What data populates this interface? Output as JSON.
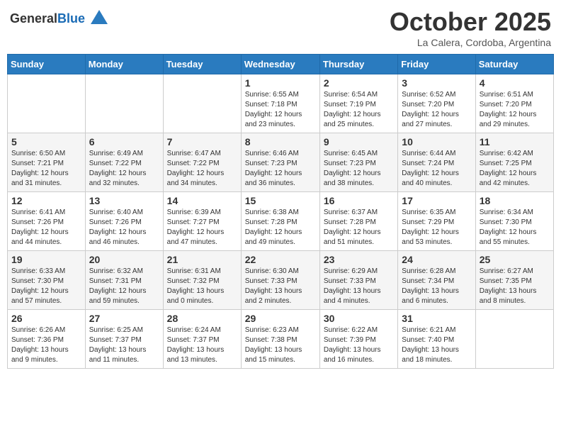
{
  "header": {
    "logo_general": "General",
    "logo_blue": "Blue",
    "month_title": "October 2025",
    "subtitle": "La Calera, Cordoba, Argentina"
  },
  "days_of_week": [
    "Sunday",
    "Monday",
    "Tuesday",
    "Wednesday",
    "Thursday",
    "Friday",
    "Saturday"
  ],
  "weeks": [
    [
      {
        "day": "",
        "info": ""
      },
      {
        "day": "",
        "info": ""
      },
      {
        "day": "",
        "info": ""
      },
      {
        "day": "1",
        "info": "Sunrise: 6:55 AM\nSunset: 7:18 PM\nDaylight: 12 hours\nand 23 minutes."
      },
      {
        "day": "2",
        "info": "Sunrise: 6:54 AM\nSunset: 7:19 PM\nDaylight: 12 hours\nand 25 minutes."
      },
      {
        "day": "3",
        "info": "Sunrise: 6:52 AM\nSunset: 7:20 PM\nDaylight: 12 hours\nand 27 minutes."
      },
      {
        "day": "4",
        "info": "Sunrise: 6:51 AM\nSunset: 7:20 PM\nDaylight: 12 hours\nand 29 minutes."
      }
    ],
    [
      {
        "day": "5",
        "info": "Sunrise: 6:50 AM\nSunset: 7:21 PM\nDaylight: 12 hours\nand 31 minutes."
      },
      {
        "day": "6",
        "info": "Sunrise: 6:49 AM\nSunset: 7:22 PM\nDaylight: 12 hours\nand 32 minutes."
      },
      {
        "day": "7",
        "info": "Sunrise: 6:47 AM\nSunset: 7:22 PM\nDaylight: 12 hours\nand 34 minutes."
      },
      {
        "day": "8",
        "info": "Sunrise: 6:46 AM\nSunset: 7:23 PM\nDaylight: 12 hours\nand 36 minutes."
      },
      {
        "day": "9",
        "info": "Sunrise: 6:45 AM\nSunset: 7:23 PM\nDaylight: 12 hours\nand 38 minutes."
      },
      {
        "day": "10",
        "info": "Sunrise: 6:44 AM\nSunset: 7:24 PM\nDaylight: 12 hours\nand 40 minutes."
      },
      {
        "day": "11",
        "info": "Sunrise: 6:42 AM\nSunset: 7:25 PM\nDaylight: 12 hours\nand 42 minutes."
      }
    ],
    [
      {
        "day": "12",
        "info": "Sunrise: 6:41 AM\nSunset: 7:26 PM\nDaylight: 12 hours\nand 44 minutes."
      },
      {
        "day": "13",
        "info": "Sunrise: 6:40 AM\nSunset: 7:26 PM\nDaylight: 12 hours\nand 46 minutes."
      },
      {
        "day": "14",
        "info": "Sunrise: 6:39 AM\nSunset: 7:27 PM\nDaylight: 12 hours\nand 47 minutes."
      },
      {
        "day": "15",
        "info": "Sunrise: 6:38 AM\nSunset: 7:28 PM\nDaylight: 12 hours\nand 49 minutes."
      },
      {
        "day": "16",
        "info": "Sunrise: 6:37 AM\nSunset: 7:28 PM\nDaylight: 12 hours\nand 51 minutes."
      },
      {
        "day": "17",
        "info": "Sunrise: 6:35 AM\nSunset: 7:29 PM\nDaylight: 12 hours\nand 53 minutes."
      },
      {
        "day": "18",
        "info": "Sunrise: 6:34 AM\nSunset: 7:30 PM\nDaylight: 12 hours\nand 55 minutes."
      }
    ],
    [
      {
        "day": "19",
        "info": "Sunrise: 6:33 AM\nSunset: 7:30 PM\nDaylight: 12 hours\nand 57 minutes."
      },
      {
        "day": "20",
        "info": "Sunrise: 6:32 AM\nSunset: 7:31 PM\nDaylight: 12 hours\nand 59 minutes."
      },
      {
        "day": "21",
        "info": "Sunrise: 6:31 AM\nSunset: 7:32 PM\nDaylight: 13 hours\nand 0 minutes."
      },
      {
        "day": "22",
        "info": "Sunrise: 6:30 AM\nSunset: 7:33 PM\nDaylight: 13 hours\nand 2 minutes."
      },
      {
        "day": "23",
        "info": "Sunrise: 6:29 AM\nSunset: 7:33 PM\nDaylight: 13 hours\nand 4 minutes."
      },
      {
        "day": "24",
        "info": "Sunrise: 6:28 AM\nSunset: 7:34 PM\nDaylight: 13 hours\nand 6 minutes."
      },
      {
        "day": "25",
        "info": "Sunrise: 6:27 AM\nSunset: 7:35 PM\nDaylight: 13 hours\nand 8 minutes."
      }
    ],
    [
      {
        "day": "26",
        "info": "Sunrise: 6:26 AM\nSunset: 7:36 PM\nDaylight: 13 hours\nand 9 minutes."
      },
      {
        "day": "27",
        "info": "Sunrise: 6:25 AM\nSunset: 7:37 PM\nDaylight: 13 hours\nand 11 minutes."
      },
      {
        "day": "28",
        "info": "Sunrise: 6:24 AM\nSunset: 7:37 PM\nDaylight: 13 hours\nand 13 minutes."
      },
      {
        "day": "29",
        "info": "Sunrise: 6:23 AM\nSunset: 7:38 PM\nDaylight: 13 hours\nand 15 minutes."
      },
      {
        "day": "30",
        "info": "Sunrise: 6:22 AM\nSunset: 7:39 PM\nDaylight: 13 hours\nand 16 minutes."
      },
      {
        "day": "31",
        "info": "Sunrise: 6:21 AM\nSunset: 7:40 PM\nDaylight: 13 hours\nand 18 minutes."
      },
      {
        "day": "",
        "info": ""
      }
    ]
  ]
}
